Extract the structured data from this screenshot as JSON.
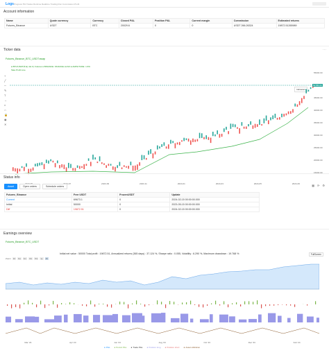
{
  "header": {
    "logo": "Logs",
    "info": "Progress  5%  Trades  Runtime  Realtime  Trading Run  Commission  Profit",
    "right_btn": ""
  },
  "account": {
    "title": "Account information",
    "columns": [
      "Name",
      "Quote currency",
      "Currency",
      "Closed P&L",
      "Position P&L",
      "Current margin",
      "Commission",
      "Estimated returns"
    ],
    "row": [
      "Futures_Binance",
      "USDT",
      "BTC",
      "20029.6",
      "0",
      "0",
      "USDT 266.26324",
      "19872.51265989"
    ]
  },
  "ticker": {
    "title": "Ticker data",
    "name": "Futures_Binance_BTC_USDT.swap",
    "indicator_line1": "● BTC/USDT(5 E)·4H·0 | Futures ● BINANCE: FINANCE·ALSO ● AMPLITUDE: 1.6%",
    "indicator_line2": "Take Profit Line",
    "indicator_btn": "Indicators",
    "price_tag": "52785.00",
    "y_ticks": [
      "55000.00",
      "50000.00",
      "45000.00",
      "40000.00",
      "35000.00",
      "30000.00",
      "25000.00",
      "20000.00",
      "15000.00"
    ],
    "x_ticks": [
      "2023-05",
      "2023-07",
      "2023-09",
      "2023-11",
      "2024-01",
      "2024-03",
      "2024-05",
      "2024-06"
    ]
  },
  "status": {
    "title": "Status info",
    "tabs": [
      "Asset",
      "Open orders",
      "Schedule orders"
    ],
    "columns": [
      "Futures_Binance",
      "Free USDT",
      "FrozenUSDT",
      "Update"
    ],
    "rows": [
      [
        "Current",
        "69673.1",
        "0",
        "2024-02-15 00:00:00.000"
      ],
      [
        "Initial",
        "50000",
        "0",
        "2023-05-15 00:00:00.000"
      ],
      [
        "Diff",
        "19872.51",
        "0",
        "2024-02-15 00:00:00.000"
      ]
    ]
  },
  "earnings": {
    "title": "Earnings overview",
    "subtitle": "Futures_Binance_BTC_USDT",
    "summary": "Initial net value : 50000 Total profit : 19872.51, Annualized returns (365 days) : 37.124 %, Sharpe ratio : 0.055, Volatility : 6.290 %, Maximum drawdown : 19.768 %",
    "fullscreen": "FullScreen",
    "zoom_label": "Zoom",
    "zoom_opts": [
      "1d",
      "1w",
      "1m",
      "3m",
      "6m",
      "1y",
      "All"
    ],
    "x_ticks": [
      "Mar '23",
      "Apr '23",
      "Jun '23",
      "Aug '23",
      "Oct '23",
      "Dec '23",
      "Feb '24"
    ],
    "legend": [
      "P&L",
      "Period P&L",
      "Trade P&L",
      "Position long",
      "Position short",
      "Asset utilization"
    ]
  }
}
